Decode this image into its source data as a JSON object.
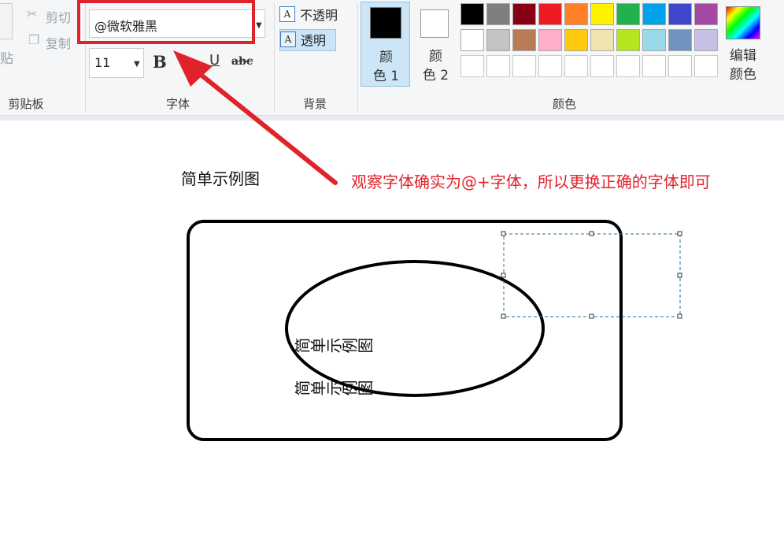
{
  "ribbon": {
    "clipboard": {
      "paste_label": "贴",
      "cut_label": "剪切",
      "copy_label": "复制",
      "group_label": "剪贴板"
    },
    "font": {
      "font_name": "@微软雅黑",
      "font_size": "11",
      "bold_label": "B",
      "underline_label": "U",
      "strike_label": "abc",
      "group_label": "字体"
    },
    "background": {
      "opaque_label": "不透明",
      "transparent_label": "透明",
      "selected": "transparent",
      "group_label": "背景"
    },
    "colors": {
      "color1_label": "颜\n色 1",
      "color1_line1": "颜",
      "color1_line2": "色 1",
      "color2_line1": "颜",
      "color2_line2": "色 2",
      "color1_value": "#000000",
      "color2_value": "#ffffff",
      "edit_line1": "编辑",
      "edit_line2": "颜色",
      "group_label": "颜色",
      "palette_row1": [
        "#000000",
        "#7f7f7f",
        "#880015",
        "#ed1c24",
        "#ff7f27",
        "#fff200",
        "#22b14c",
        "#00a2e8",
        "#3f48cc",
        "#a349a4"
      ],
      "palette_row2": [
        "#ffffff",
        "#c3c3c3",
        "#b97a57",
        "#ffaec9",
        "#ffc90e",
        "#efe4b0",
        "#b5e61d",
        "#99d9ea",
        "#7092be",
        "#c8bfe7"
      ],
      "palette_row3": [
        "#ffffff",
        "#ffffff",
        "#ffffff",
        "#ffffff",
        "#ffffff",
        "#ffffff",
        "#ffffff",
        "#ffffff",
        "#ffffff",
        "#ffffff"
      ]
    }
  },
  "canvas": {
    "title": "简单示例图",
    "annotation": "观察字体确实为@+字体，所以更换正确的字体即可",
    "vertical_text_1": "简单示例图",
    "vertical_text_2": "简单示例图",
    "highlight_color": "#e0232b"
  },
  "icons": [
    "scissors-icon",
    "copy-icon",
    "paste-icon",
    "dropdown-arrow-icon",
    "edit-colors-icon",
    "arrow-annotation"
  ]
}
